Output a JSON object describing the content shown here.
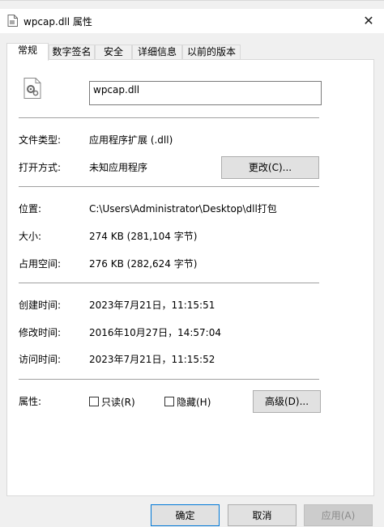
{
  "window": {
    "title": "wpcap.dll 属性",
    "close_glyph": "✕"
  },
  "tabs": [
    {
      "label": "常规",
      "active": true
    },
    {
      "label": "数字签名",
      "active": false
    },
    {
      "label": "安全",
      "active": false
    },
    {
      "label": "详细信息",
      "active": false
    },
    {
      "label": "以前的版本",
      "active": false
    }
  ],
  "general": {
    "file_name": "wpcap.dll",
    "file_type_label": "文件类型:",
    "file_type_value": "应用程序扩展 (.dll)",
    "opens_with_label": "打开方式:",
    "opens_with_value": "未知应用程序",
    "change_button": "更改(C)...",
    "location_label": "位置:",
    "location_value": "C:\\Users\\Administrator\\Desktop\\dll打包",
    "size_label": "大小:",
    "size_value": "274 KB (281,104 字节)",
    "size_on_disk_label": "占用空间:",
    "size_on_disk_value": "276 KB (282,624 字节)",
    "created_label": "创建时间:",
    "created_value": "2023年7月21日，11:15:51",
    "modified_label": "修改时间:",
    "modified_value": "2016年10月27日，14:57:04",
    "accessed_label": "访问时间:",
    "accessed_value": "2023年7月21日，11:15:52",
    "attributes_label": "属性:",
    "readonly_label": "只读(R)",
    "readonly_checked": false,
    "hidden_label": "隐藏(H)",
    "hidden_checked": false,
    "advanced_button": "高级(D)..."
  },
  "footer": {
    "ok_button": "确定",
    "cancel_button": "取消",
    "apply_button": "应用(A)"
  },
  "colors": {
    "accent": "#0078d7",
    "panel_bg": "#ffffff",
    "window_bg": "#f0f0f0"
  },
  "icons": {
    "app_icon": "document-icon",
    "file_icon": "dll-gear-file-icon",
    "close": "close-icon"
  }
}
